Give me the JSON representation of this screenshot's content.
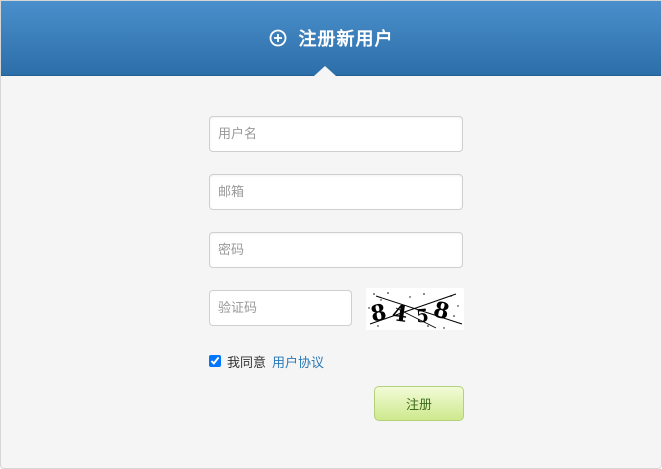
{
  "header": {
    "title": "注册新用户",
    "icon": "plus-circle-icon",
    "background_color": "#3b7fbd"
  },
  "form": {
    "username_placeholder": "用户名",
    "username_value": "",
    "email_placeholder": "邮箱",
    "email_value": "",
    "password_placeholder": "密码",
    "password_value": "",
    "captcha_placeholder": "验证码",
    "captcha_value": "",
    "captcha_image_text": "8458",
    "agree_checked": true,
    "agree_label": "我同意",
    "agree_link": "用户协议",
    "submit_label": "注册"
  },
  "colors": {
    "link": "#2a7ab8",
    "submit_bg": "#d8ef9f"
  }
}
